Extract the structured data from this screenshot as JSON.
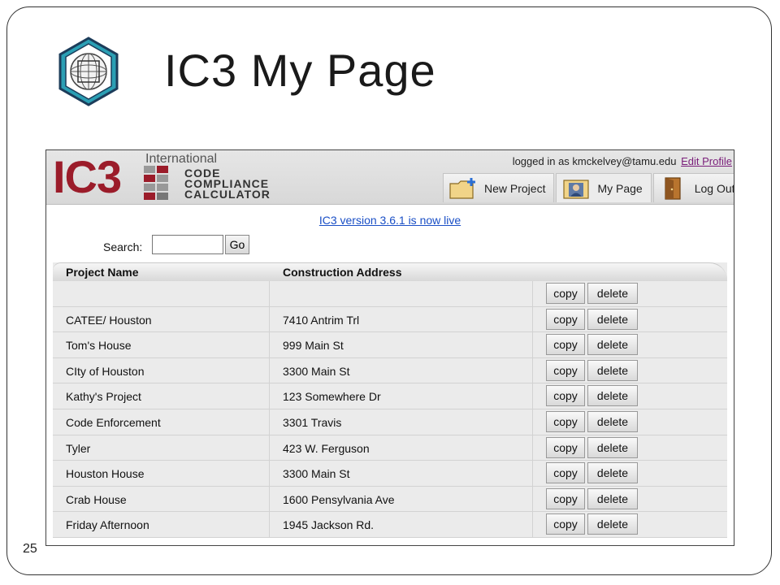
{
  "slide": {
    "title": "IC3 My Page",
    "number": "25"
  },
  "header": {
    "brand": "IC3",
    "brand_lines": [
      "International",
      "CODE",
      "COMPLIANCE",
      "CALCULATOR"
    ],
    "login_prefix": "logged in as kmckelvey@tamu.edu",
    "edit_profile": "Edit Profile",
    "tabs": [
      {
        "label": "New Project",
        "icon": "new-folder-icon"
      },
      {
        "label": "My Page",
        "icon": "user-page-icon"
      },
      {
        "label": "Log Out",
        "icon": "door-exit-icon"
      }
    ]
  },
  "notice": "IC3 version 3.6.1 is now live",
  "search": {
    "label": "Search:",
    "value": "",
    "go_label": "Go"
  },
  "table": {
    "columns": [
      "Project Name",
      "Construction Address"
    ],
    "copy_label": "copy",
    "delete_label": "delete",
    "rows": [
      {
        "name": "",
        "address": ""
      },
      {
        "name": "CATEE/ Houston",
        "address": "7410 Antrim Trl"
      },
      {
        "name": "Tom's House",
        "address": "999 Main St"
      },
      {
        "name": "CIty of Houston",
        "address": "3300 Main St"
      },
      {
        "name": "Kathy's Project",
        "address": "123 Somewhere Dr"
      },
      {
        "name": "Code Enforcement",
        "address": "3301 Travis"
      },
      {
        "name": "Tyler",
        "address": "423 W. Ferguson"
      },
      {
        "name": "Houston House",
        "address": "3300 Main St"
      },
      {
        "name": "Crab House",
        "address": "1600 Pensylvania Ave"
      },
      {
        "name": "Friday Afternoon",
        "address": "1945 Jackson Rd."
      }
    ]
  },
  "colors": {
    "brand_red": "#9b1c2a",
    "link_blue": "#1a4fc6",
    "edit_purple": "#7a1e7a",
    "logo_teal": "#2b9fb4"
  }
}
